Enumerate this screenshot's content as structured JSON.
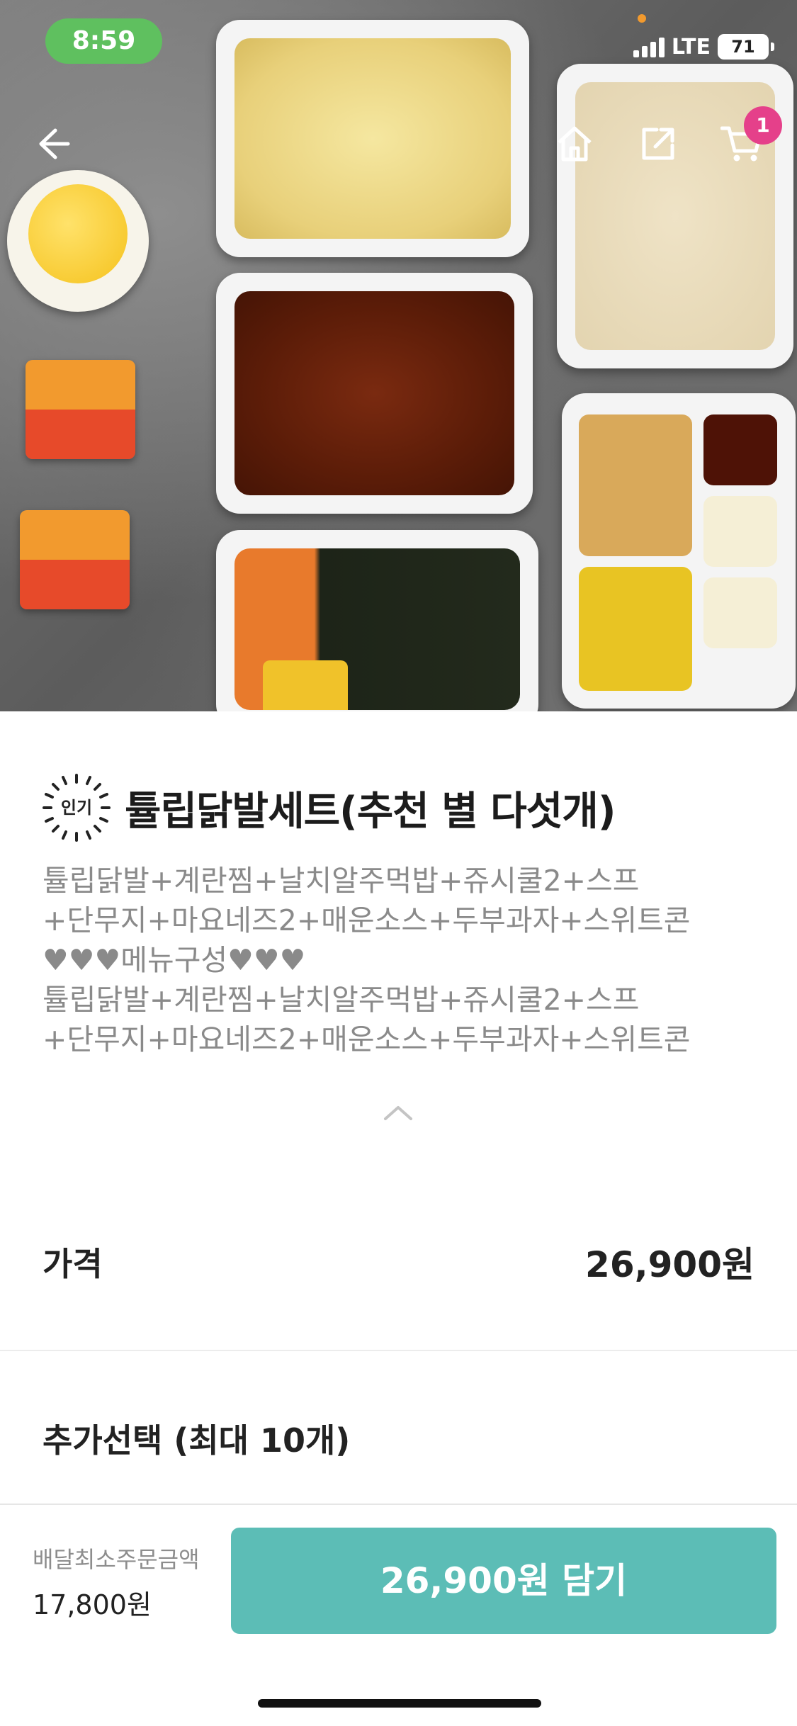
{
  "status_bar": {
    "time": "8:59",
    "network": "LTE",
    "battery": "71"
  },
  "header": {
    "cart_count": "1"
  },
  "icons": {
    "back": "arrow-left-icon",
    "home": "home-icon",
    "share": "share-icon",
    "cart": "cart-icon",
    "popular": "popular-badge-icon",
    "collapse": "chevron-up-icon"
  },
  "product": {
    "badge": "인기",
    "title": "튤립닭발세트(추천 별 다섯개)",
    "description_lines": [
      "튤립닭발+계란찜+날치알주먹밥+쥬시쿨2+스프",
      "+단무지+마요네즈2+매운소스+두부과자+스위트콘",
      "♥♥♥메뉴구성♥♥♥",
      "튤립닭발+계란찜+날치알주먹밥+쥬시쿨2+스프",
      "+단무지+마요네즈2+매운소스+두부과자+스위트콘"
    ]
  },
  "price": {
    "label": "가격",
    "value": "26,900원"
  },
  "options": {
    "title": "추가선택 (최대 10개)"
  },
  "bottom_bar": {
    "min_order_label": "배달최소주문금액",
    "min_order_value": "17,800원",
    "add_button": "26,900원 담기"
  },
  "colors": {
    "accent": "#5cbdb6",
    "badge": "#e5408a",
    "time_pill": "#5fc05f"
  }
}
